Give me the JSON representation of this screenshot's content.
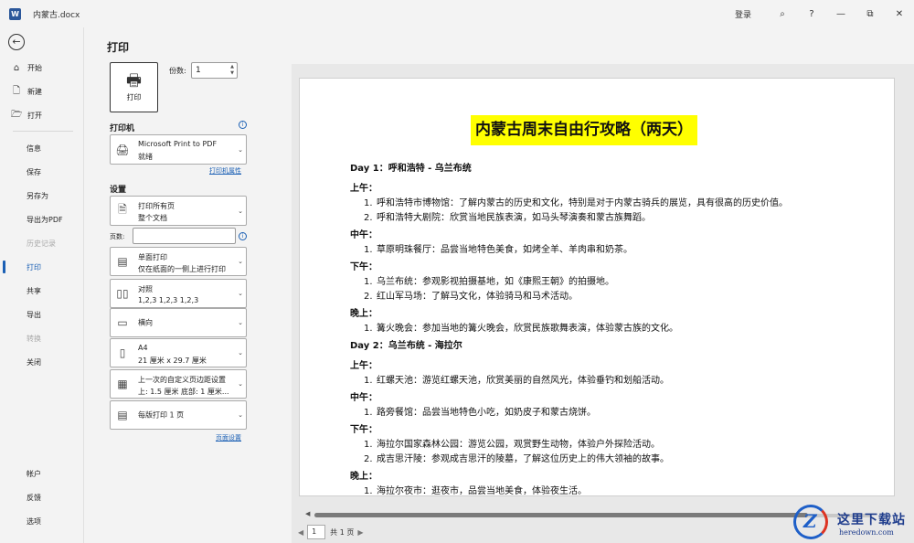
{
  "window": {
    "title": "内蒙古.docx",
    "app_icon": "W",
    "login": "登录",
    "buttons": {
      "feedback_icon": "⌕",
      "help": "?",
      "minimize": "—",
      "restore": "⧉",
      "close": "✕"
    }
  },
  "nav": {
    "back_icon": "←",
    "top": [
      {
        "label": "开始",
        "icon": "⌂"
      },
      {
        "label": "新建",
        "icon": "🗋"
      },
      {
        "label": "打开",
        "icon": "🗁"
      }
    ],
    "middle": [
      "信息",
      "保存",
      "另存为",
      "导出为PDF",
      "历史记录",
      "打印",
      "共享",
      "导出",
      "转换",
      "关闭"
    ],
    "bottom": [
      "帐户",
      "反馈",
      "选项"
    ]
  },
  "panel": {
    "title": "打印",
    "print_button": "打印",
    "copies_label": "份数:",
    "copies_value": "1",
    "printer_section": "打印机",
    "printer": {
      "name": "Microsoft Print to PDF",
      "status": "就绪"
    },
    "printer_props_link": "打印机属性",
    "settings_section": "设置",
    "range": {
      "line1": "打印所有页",
      "line2": "整个文档"
    },
    "pages_label": "页数:",
    "sides": {
      "line1": "单面打印",
      "line2": "仅在纸面的一侧上进行打印"
    },
    "collate": {
      "line1": "对照",
      "line2": "1,2,3    1,2,3    1,2,3"
    },
    "orientation": "横向",
    "paper": {
      "line1": "A4",
      "line2": "21 厘米 x 29.7 厘米"
    },
    "margins": {
      "line1": "上一次的自定义页边距设置",
      "line2": "上: 1.5 厘米 底部: 1 厘米..."
    },
    "per_page": "每版打印 1 页",
    "page_setup_link": "页面设置"
  },
  "document": {
    "title": "内蒙古周末自由行攻略（两天）",
    "day1": {
      "heading": "Day 1：呼和浩特 - 乌兰布统",
      "morning": "上午：",
      "morning_items": [
        "呼和浩特市博物馆：了解内蒙古的历史和文化，特别是对于内蒙古骑兵的展览，具有很高的历史价值。",
        "呼和浩特大剧院：欣赏当地民族表演，如马头琴演奏和蒙古族舞蹈。"
      ],
      "noon": "中午：",
      "noon_items": [
        "草原明珠餐厅：品尝当地特色美食，如烤全羊、羊肉串和奶茶。"
      ],
      "afternoon": "下午：",
      "afternoon_items": [
        "乌兰布统：参观影视拍摄基地，如《康熙王朝》的拍摄地。",
        "红山军马场：了解马文化，体验骑马和马术活动。"
      ],
      "evening": "晚上：",
      "evening_items": [
        "篝火晚会：参加当地的篝火晚会，欣赏民族歌舞表演，体验蒙古族的文化。"
      ]
    },
    "day2": {
      "heading": "Day 2：乌兰布统 - 海拉尔",
      "morning": "上午：",
      "morning_items": [
        "红螺天池：游览红螺天池，欣赏美丽的自然风光，体验垂钓和划船活动。"
      ],
      "noon": "中午：",
      "noon_items": [
        "路旁餐馆：品尝当地特色小吃，如奶皮子和蒙古烧饼。"
      ],
      "afternoon": "下午：",
      "afternoon_items": [
        "海拉尔国家森林公园：游览公园，观赏野生动物，体验户外探险活动。",
        "成吉思汗陵：参观成吉思汗的陵墓，了解这位历史上的伟大领袖的故事。"
      ],
      "evening": "晚上：",
      "evening_items": [
        "海拉尔夜市：逛夜市，品尝当地美食，体验夜生活。"
      ]
    }
  },
  "pager": {
    "current": "1",
    "total": "共 1 页"
  },
  "watermark": {
    "name": "这里下载站",
    "url": "heredown.com",
    "logo": "Z"
  },
  "nums": [
    "1.",
    "2."
  ]
}
